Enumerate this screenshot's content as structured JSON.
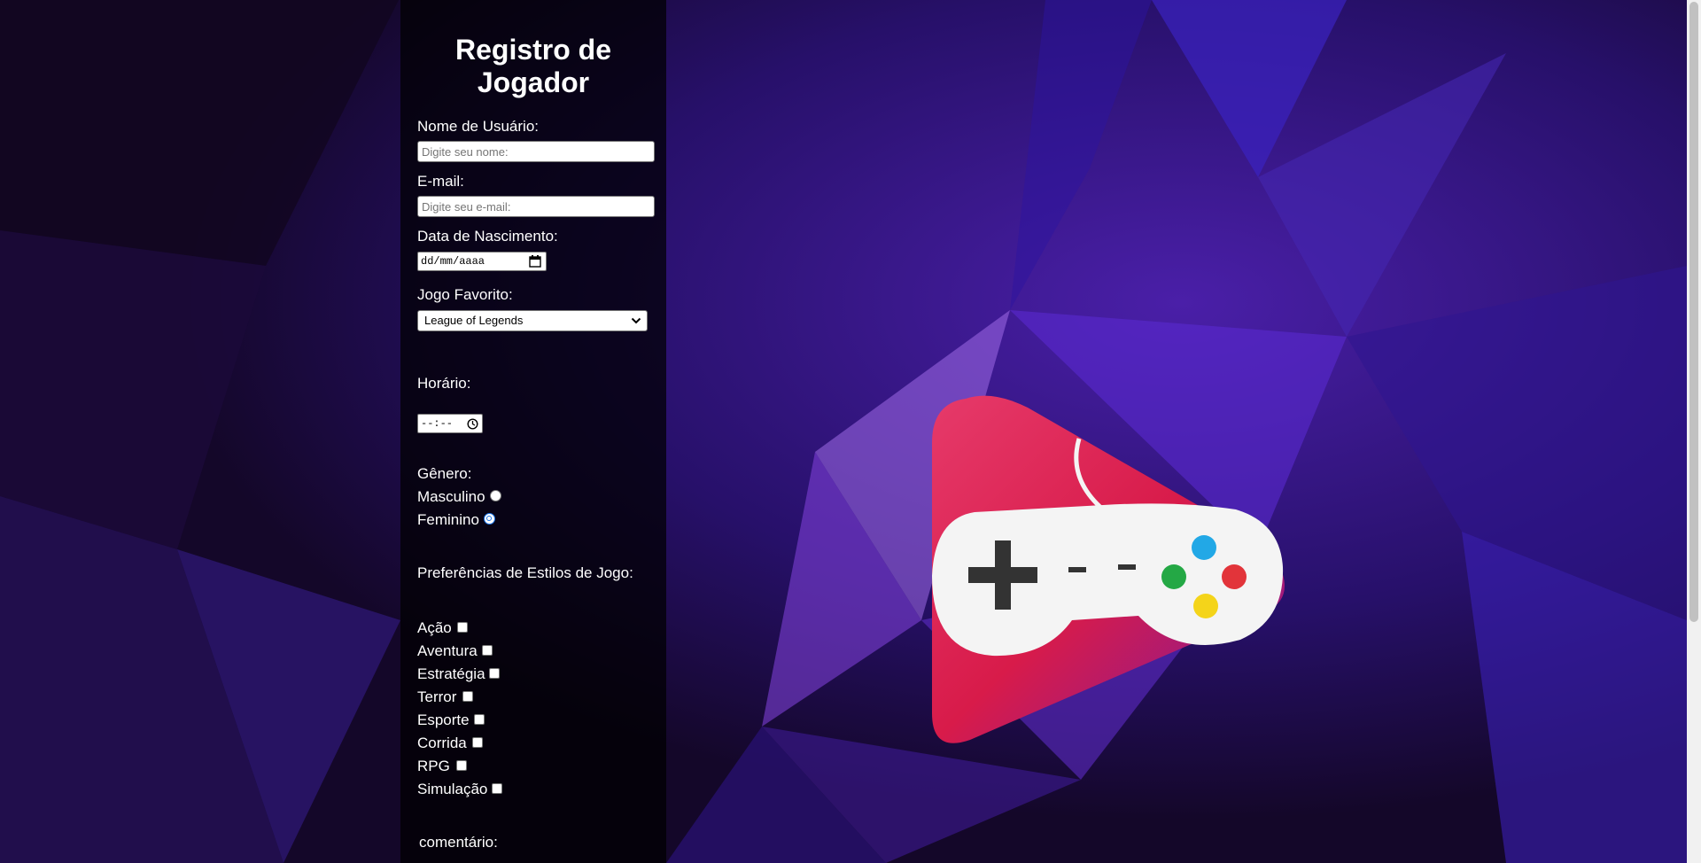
{
  "form": {
    "title_line1": "Registro de",
    "title_line2": "Jogador",
    "username_label": "Nome de Usuário:",
    "username_placeholder": "Digite seu nome:",
    "email_label": "E-mail:",
    "email_placeholder": "Digite seu e-mail:",
    "birthdate_label": "Data de Nascimento:",
    "birthdate_value": "dd/mm/aaaa",
    "favorite_game_label": "Jogo Favorito:",
    "favorite_game_selected": "League of Legends",
    "time_label": "Horário:",
    "time_value": "--:--",
    "gender_label": "Gênero:",
    "gender_options": [
      {
        "label": "Masculino",
        "checked": false
      },
      {
        "label": "Feminino",
        "checked": true
      }
    ],
    "styles_label": "Preferências de Estilos de Jogo:",
    "styles": [
      {
        "label": "Ação",
        "checked": false
      },
      {
        "label": "Aventura",
        "checked": false
      },
      {
        "label": "Estratégia",
        "checked": false
      },
      {
        "label": "Terror",
        "checked": false
      },
      {
        "label": "Esporte",
        "checked": false
      },
      {
        "label": "Corrida",
        "checked": false
      },
      {
        "label": "RPG",
        "checked": false
      },
      {
        "label": "Simulação",
        "checked": false
      }
    ],
    "comment_label": "comentário:"
  },
  "colors": {
    "background": "#1a0838",
    "panel": "rgba(0,0,0,0.72)",
    "radio_checked": "#1a73e8",
    "logo_red": "#e8194a",
    "controller_white": "#f4f4f4"
  },
  "icons": [
    "calendar-icon",
    "clock-icon",
    "chevron-down-icon",
    "game-controller-logo"
  ]
}
